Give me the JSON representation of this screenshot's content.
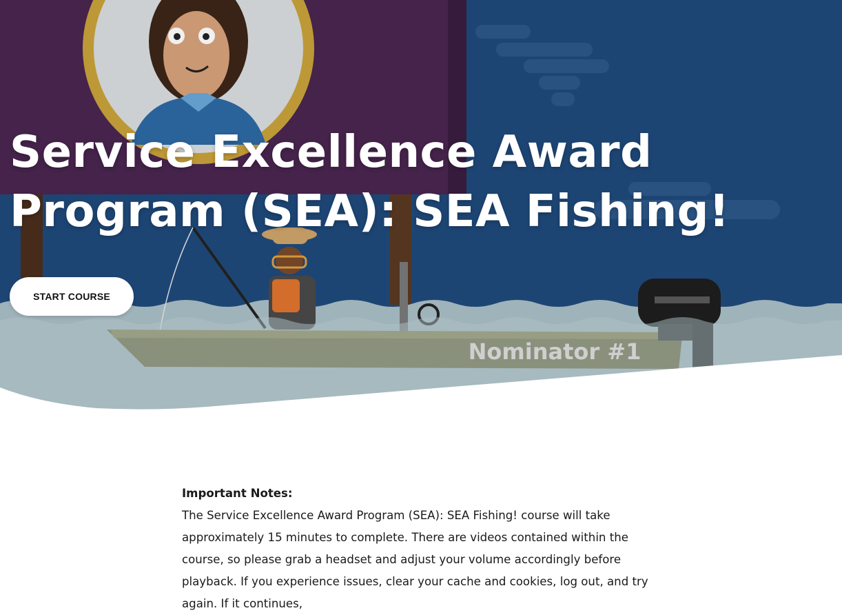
{
  "hero": {
    "title": "Service Excellence Award Program (SEA): SEA Fishing!",
    "boat_label": "Nominator #1",
    "start_button_label": "START COURSE"
  },
  "content": {
    "notes_heading": "Important Notes:",
    "notes_body": "The Service Excellence Award Program (SEA): SEA Fishing! course will take approximately 15 minutes to complete. There are videos contained within the course, so please grab a headset and adjust your volume accordingly before playback. If you experience issues, clear your cache and cookies, log out, and try again. If it continues,"
  },
  "colors": {
    "sky_blue": "#1f4a7c",
    "banner_purple": "#4a2650",
    "water": "#a9bfc6",
    "boat_olive": "#6b6434",
    "button_bg": "#ffffff",
    "text": "#1a1a1a"
  },
  "icons": [
    "profile-portrait",
    "fisherman",
    "fishing-rod",
    "motor",
    "steering-wheel"
  ]
}
